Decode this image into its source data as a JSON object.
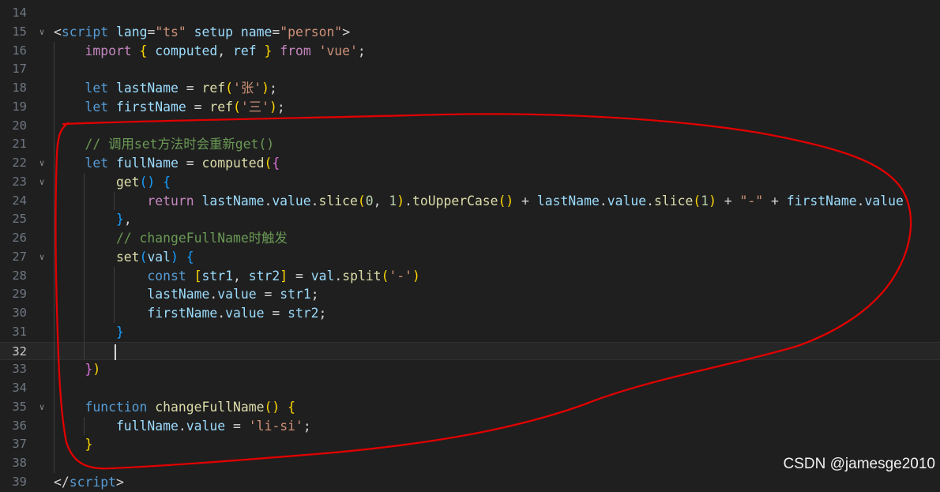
{
  "editor": {
    "active_line": "32",
    "lines": [
      {
        "num": "14",
        "fold": "",
        "tokens": []
      },
      {
        "num": "15",
        "fold": "∨",
        "tokens": [
          {
            "t": "<",
            "c": "t-op"
          },
          {
            "t": "script",
            "c": "t-tag"
          },
          {
            "t": " lang",
            "c": "t-var"
          },
          {
            "t": "=",
            "c": "t-op"
          },
          {
            "t": "\"ts\"",
            "c": "t-str"
          },
          {
            "t": " setup",
            "c": "t-var"
          },
          {
            "t": " name",
            "c": "t-var"
          },
          {
            "t": "=",
            "c": "t-op"
          },
          {
            "t": "\"person\"",
            "c": "t-str"
          },
          {
            "t": ">",
            "c": "t-op"
          }
        ]
      },
      {
        "num": "16",
        "fold": "",
        "tokens": [
          {
            "t": "    import",
            "c": "t-ctl"
          },
          {
            "t": " {",
            "c": "t-br1"
          },
          {
            "t": " computed",
            "c": "t-var"
          },
          {
            "t": ",",
            "c": "t-pl"
          },
          {
            "t": " ref",
            "c": "t-var"
          },
          {
            "t": " }",
            "c": "t-br1"
          },
          {
            "t": " from",
            "c": "t-ctl"
          },
          {
            "t": " 'vue'",
            "c": "t-str"
          },
          {
            "t": ";",
            "c": "t-pl"
          }
        ]
      },
      {
        "num": "17",
        "fold": "",
        "tokens": []
      },
      {
        "num": "18",
        "fold": "",
        "tokens": [
          {
            "t": "    let",
            "c": "t-kw"
          },
          {
            "t": " lastName",
            "c": "t-var"
          },
          {
            "t": " =",
            "c": "t-op"
          },
          {
            "t": " ref",
            "c": "t-fn"
          },
          {
            "t": "(",
            "c": "t-br1"
          },
          {
            "t": "'张'",
            "c": "t-str"
          },
          {
            "t": ")",
            "c": "t-br1"
          },
          {
            "t": ";",
            "c": "t-pl"
          }
        ]
      },
      {
        "num": "19",
        "fold": "",
        "tokens": [
          {
            "t": "    let",
            "c": "t-kw"
          },
          {
            "t": " firstName",
            "c": "t-var"
          },
          {
            "t": " =",
            "c": "t-op"
          },
          {
            "t": " ref",
            "c": "t-fn"
          },
          {
            "t": "(",
            "c": "t-br1"
          },
          {
            "t": "'三'",
            "c": "t-str"
          },
          {
            "t": ")",
            "c": "t-br1"
          },
          {
            "t": ";",
            "c": "t-pl"
          }
        ]
      },
      {
        "num": "20",
        "fold": "",
        "tokens": []
      },
      {
        "num": "21",
        "fold": "",
        "tokens": [
          {
            "t": "    // 调用set方法时会重新get()",
            "c": "t-cmt"
          }
        ]
      },
      {
        "num": "22",
        "fold": "∨",
        "tokens": [
          {
            "t": "    let",
            "c": "t-kw"
          },
          {
            "t": " fullName",
            "c": "t-var"
          },
          {
            "t": " =",
            "c": "t-op"
          },
          {
            "t": " computed",
            "c": "t-fn"
          },
          {
            "t": "(",
            "c": "t-br1"
          },
          {
            "t": "{",
            "c": "t-br2"
          }
        ]
      },
      {
        "num": "23",
        "fold": "∨",
        "tokens": [
          {
            "t": "        get",
            "c": "t-fn"
          },
          {
            "t": "()",
            "c": "t-br3"
          },
          {
            "t": " {",
            "c": "t-br3"
          }
        ]
      },
      {
        "num": "24",
        "fold": "",
        "tokens": [
          {
            "t": "            return",
            "c": "t-ctl"
          },
          {
            "t": " lastName",
            "c": "t-var"
          },
          {
            "t": ".",
            "c": "t-pl"
          },
          {
            "t": "value",
            "c": "t-var"
          },
          {
            "t": ".",
            "c": "t-pl"
          },
          {
            "t": "slice",
            "c": "t-fn"
          },
          {
            "t": "(",
            "c": "t-br1"
          },
          {
            "t": "0",
            "c": "t-num"
          },
          {
            "t": ", ",
            "c": "t-pl"
          },
          {
            "t": "1",
            "c": "t-num"
          },
          {
            "t": ")",
            "c": "t-br1"
          },
          {
            "t": ".",
            "c": "t-pl"
          },
          {
            "t": "toUpperCase",
            "c": "t-fn"
          },
          {
            "t": "()",
            "c": "t-br1"
          },
          {
            "t": " +",
            "c": "t-op"
          },
          {
            "t": " lastName",
            "c": "t-var"
          },
          {
            "t": ".",
            "c": "t-pl"
          },
          {
            "t": "value",
            "c": "t-var"
          },
          {
            "t": ".",
            "c": "t-pl"
          },
          {
            "t": "slice",
            "c": "t-fn"
          },
          {
            "t": "(",
            "c": "t-br1"
          },
          {
            "t": "1",
            "c": "t-num"
          },
          {
            "t": ")",
            "c": "t-br1"
          },
          {
            "t": " +",
            "c": "t-op"
          },
          {
            "t": " \"-\"",
            "c": "t-str"
          },
          {
            "t": " +",
            "c": "t-op"
          },
          {
            "t": " firstName",
            "c": "t-var"
          },
          {
            "t": ".",
            "c": "t-pl"
          },
          {
            "t": "value",
            "c": "t-var"
          }
        ]
      },
      {
        "num": "25",
        "fold": "",
        "tokens": [
          {
            "t": "        }",
            "c": "t-br3"
          },
          {
            "t": ",",
            "c": "t-pl"
          }
        ]
      },
      {
        "num": "26",
        "fold": "",
        "tokens": [
          {
            "t": "        // changeFullName时触发",
            "c": "t-cmt"
          }
        ]
      },
      {
        "num": "27",
        "fold": "∨",
        "tokens": [
          {
            "t": "        set",
            "c": "t-fn"
          },
          {
            "t": "(",
            "c": "t-br3"
          },
          {
            "t": "val",
            "c": "t-var"
          },
          {
            "t": ")",
            "c": "t-br3"
          },
          {
            "t": " {",
            "c": "t-br3"
          }
        ]
      },
      {
        "num": "28",
        "fold": "",
        "tokens": [
          {
            "t": "            const",
            "c": "t-kw"
          },
          {
            "t": " [",
            "c": "t-br1"
          },
          {
            "t": "str1",
            "c": "t-var"
          },
          {
            "t": ", ",
            "c": "t-pl"
          },
          {
            "t": "str2",
            "c": "t-var"
          },
          {
            "t": "]",
            "c": "t-br1"
          },
          {
            "t": " =",
            "c": "t-op"
          },
          {
            "t": " val",
            "c": "t-var"
          },
          {
            "t": ".",
            "c": "t-pl"
          },
          {
            "t": "split",
            "c": "t-fn"
          },
          {
            "t": "(",
            "c": "t-br1"
          },
          {
            "t": "'-'",
            "c": "t-str"
          },
          {
            "t": ")",
            "c": "t-br1"
          }
        ]
      },
      {
        "num": "29",
        "fold": "",
        "tokens": [
          {
            "t": "            lastName",
            "c": "t-var"
          },
          {
            "t": ".",
            "c": "t-pl"
          },
          {
            "t": "value",
            "c": "t-var"
          },
          {
            "t": " =",
            "c": "t-op"
          },
          {
            "t": " str1",
            "c": "t-var"
          },
          {
            "t": ";",
            "c": "t-pl"
          }
        ]
      },
      {
        "num": "30",
        "fold": "",
        "tokens": [
          {
            "t": "            firstName",
            "c": "t-var"
          },
          {
            "t": ".",
            "c": "t-pl"
          },
          {
            "t": "value",
            "c": "t-var"
          },
          {
            "t": " =",
            "c": "t-op"
          },
          {
            "t": " str2",
            "c": "t-var"
          },
          {
            "t": ";",
            "c": "t-pl"
          }
        ]
      },
      {
        "num": "31",
        "fold": "",
        "tokens": [
          {
            "t": "        }",
            "c": "t-br3"
          }
        ]
      },
      {
        "num": "32",
        "fold": "",
        "tokens": []
      },
      {
        "num": "33",
        "fold": "",
        "tokens": [
          {
            "t": "    }",
            "c": "t-br2"
          },
          {
            "t": ")",
            "c": "t-br1"
          }
        ]
      },
      {
        "num": "34",
        "fold": "",
        "tokens": []
      },
      {
        "num": "35",
        "fold": "∨",
        "tokens": [
          {
            "t": "    function",
            "c": "t-kw"
          },
          {
            "t": " changeFullName",
            "c": "t-fn"
          },
          {
            "t": "()",
            "c": "t-br1"
          },
          {
            "t": " {",
            "c": "t-br1"
          }
        ]
      },
      {
        "num": "36",
        "fold": "",
        "tokens": [
          {
            "t": "        fullName",
            "c": "t-var"
          },
          {
            "t": ".",
            "c": "t-pl"
          },
          {
            "t": "value",
            "c": "t-var"
          },
          {
            "t": " =",
            "c": "t-op"
          },
          {
            "t": " 'li-si'",
            "c": "t-str"
          },
          {
            "t": ";",
            "c": "t-pl"
          }
        ]
      },
      {
        "num": "37",
        "fold": "",
        "tokens": [
          {
            "t": "    }",
            "c": "t-br1"
          }
        ]
      },
      {
        "num": "38",
        "fold": "",
        "tokens": []
      },
      {
        "num": "39",
        "fold": "",
        "tokens": [
          {
            "t": "</",
            "c": "t-op"
          },
          {
            "t": "script",
            "c": "t-tag"
          },
          {
            "t": ">",
            "c": "t-op"
          }
        ]
      }
    ]
  },
  "annotation": {
    "color": "#e00000",
    "shape": "hand-drawn-loop"
  },
  "watermark": {
    "text": "CSDN @jamesge2010"
  }
}
